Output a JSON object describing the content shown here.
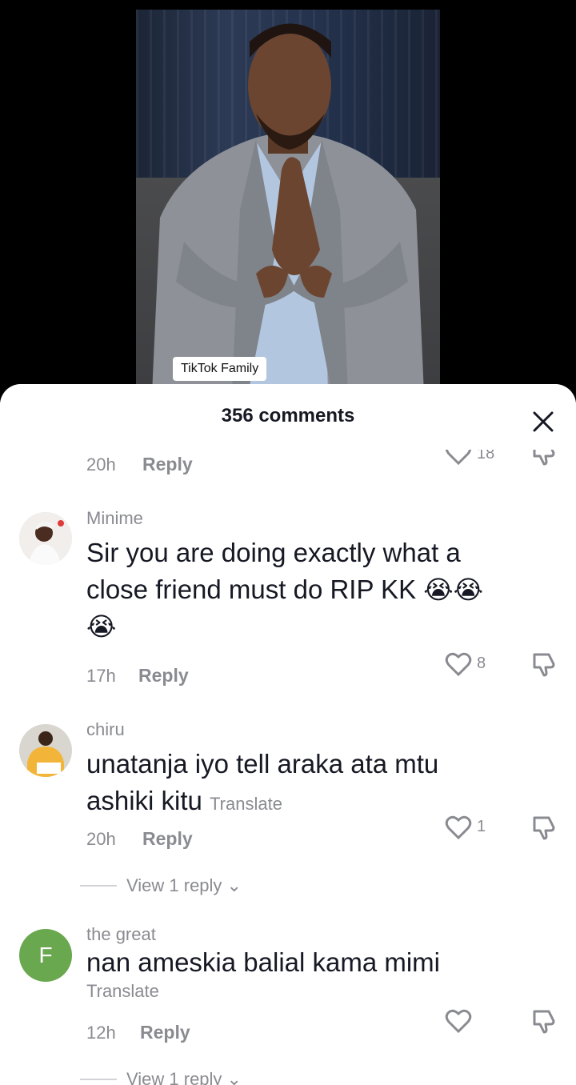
{
  "video": {
    "label": "TikTok Family"
  },
  "sheet": {
    "title": "356 comments",
    "close_icon": "close-icon"
  },
  "partial_comment": {
    "time": "20h",
    "reply_label": "Reply",
    "likes": "18"
  },
  "comments": [
    {
      "username": "Minime",
      "text_line1": "Sir you are doing exactly what a",
      "text_line2": "close friend must do RIP KK",
      "emoji_inline": "😭😭",
      "emoji_line3": "😭",
      "time": "17h",
      "reply_label": "Reply",
      "likes": "8"
    },
    {
      "username": "chiru",
      "text_line1": "unatanja iyo tell araka ata mtu",
      "text_line2": "ashiki kitu",
      "translate_label": "Translate",
      "time": "20h",
      "reply_label": "Reply",
      "likes": "1",
      "view_replies": "View 1 reply ⌄"
    },
    {
      "username": "the great",
      "avatar_letter": "F",
      "avatar_color": "#6aa84f",
      "text_line1": "nan ameskia balial kama mimi",
      "translate_label": "Translate",
      "time": "12h",
      "reply_label": "Reply",
      "view_replies": "View 1 reply ⌄"
    }
  ],
  "colors": {
    "text_primary": "#161823",
    "text_secondary": "#8a8b91"
  }
}
